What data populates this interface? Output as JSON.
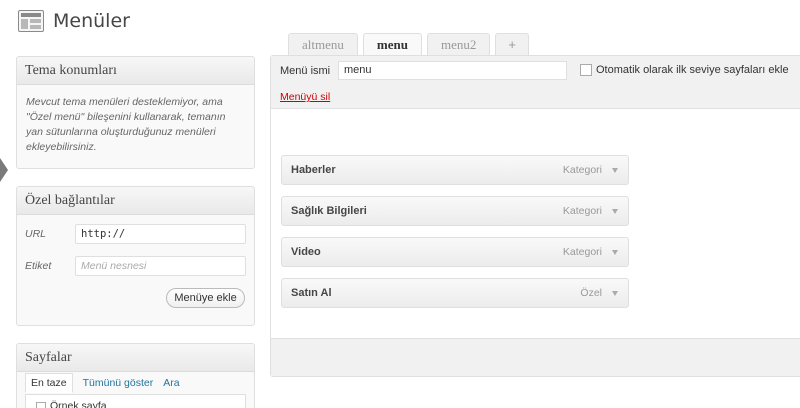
{
  "page": {
    "title": "Menüler"
  },
  "theme_locations": {
    "title": "Tema konumları",
    "description": "Mevcut tema menüleri desteklemiyor, ama \"Özel menü\" bileşenini kullanarak, temanın yan sütunlarına oluşturduğunuz menüleri ekleyebilirsiniz."
  },
  "custom_links": {
    "title": "Özel bağlantılar",
    "url_label": "URL",
    "url_value": "http://",
    "label_label": "Etiket",
    "label_placeholder": "Menü nesnesi",
    "add_button": "Menüye ekle"
  },
  "pages_box": {
    "title": "Sayfalar",
    "tabs": [
      "En taze",
      "Tümünü göster",
      "Ara"
    ],
    "first_item": "Örnek sayfa"
  },
  "menu_tabs": [
    "altmenu",
    "menu",
    "menu2",
    "+"
  ],
  "menu_editor": {
    "name_label": "Menü ismi",
    "name_value": "menu",
    "auto_add_label": "Otomatik olarak ilk seviye sayfaları ekle",
    "delete_link": "Menüyü sil",
    "items": [
      {
        "title": "Haberler",
        "type": "Kategori"
      },
      {
        "title": "Sağlık Bilgileri",
        "type": "Kategori"
      },
      {
        "title": "Video",
        "type": "Kategori"
      },
      {
        "title": "Satın Al",
        "type": "Özel"
      }
    ]
  },
  "colors": {
    "link": "#21759b",
    "delete": "#cc0000"
  }
}
